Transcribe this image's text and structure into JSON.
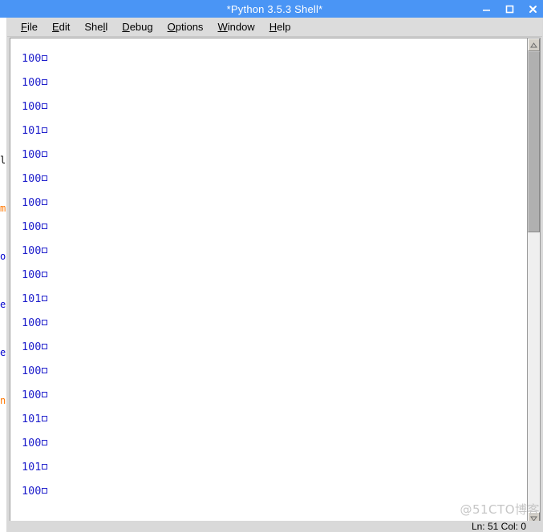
{
  "window": {
    "title": "*Python 3.5.3 Shell*",
    "controls": [
      {
        "name": "minimize-button",
        "glyph": "minimize"
      },
      {
        "name": "maximize-button",
        "glyph": "maximize"
      },
      {
        "name": "close-button",
        "glyph": "close"
      }
    ],
    "titlebar_color": "#4a95f5",
    "titlebar_text_color": "#ffffff"
  },
  "menubar": {
    "items": [
      {
        "label": "File",
        "mnemonic": "F"
      },
      {
        "label": "Edit",
        "mnemonic": "E"
      },
      {
        "label": "Shell",
        "mnemonic": "l"
      },
      {
        "label": "Debug",
        "mnemonic": "D"
      },
      {
        "label": "Options",
        "mnemonic": "O"
      },
      {
        "label": "Window",
        "mnemonic": "W"
      },
      {
        "label": "Help",
        "mnemonic": "H"
      }
    ]
  },
  "shell_output": {
    "text_color": "#2020cc",
    "lines": [
      "100",
      "100",
      "100",
      "101",
      "100",
      "100",
      "100",
      "100",
      "100",
      "100",
      "101",
      "100",
      "100",
      "100",
      "100",
      "101",
      "100",
      "101",
      "100"
    ],
    "trailing_glyph": "control-character-box"
  },
  "scrollbar": {
    "up_arrow": "scroll-up-arrow",
    "down_arrow": "scroll-down-arrow",
    "thumb_name": "scroll-thumb"
  },
  "statusbar": {
    "position": "Ln: 51  Col: 0"
  },
  "watermark": {
    "text": "@51CTO博客"
  },
  "background_editor": {
    "code_fragments": [
      "le",
      "mp",
      "or",
      "el",
      "el",
      "n:"
    ]
  }
}
